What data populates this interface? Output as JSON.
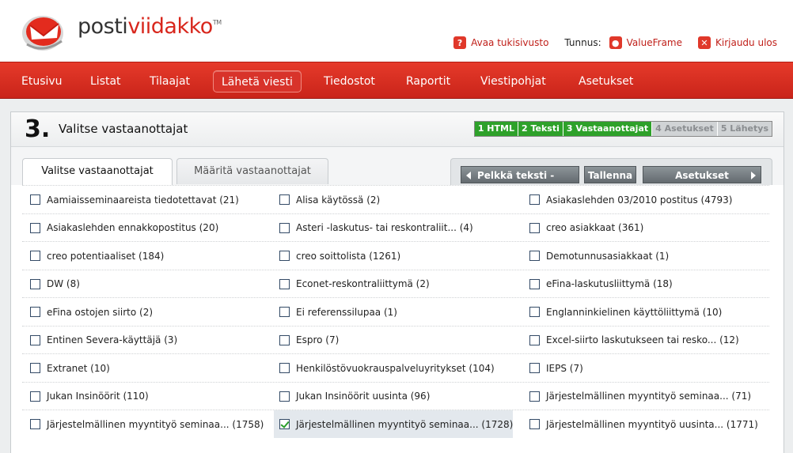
{
  "brand": {
    "part1": "posti",
    "part2": "viidakko",
    "tm": "TM"
  },
  "topnav": {
    "support": "Avaa tukisivusto",
    "account_label": "Tunnus:",
    "account_name": "ValueFrame",
    "logout": "Kirjaudu ulos"
  },
  "nav": [
    "Etusivu",
    "Listat",
    "Tilaajat",
    "Lähetä viesti",
    "Tiedostot",
    "Raportit",
    "Viestipohjat",
    "Asetukset"
  ],
  "step": {
    "number": "3.",
    "title": "Valitse vastaanottajat"
  },
  "steps": [
    "1 HTML",
    "2 Teksti",
    "3 Vastaanottajat",
    "4 Asetukset",
    "5 Lähetys"
  ],
  "tabs": {
    "active": "Valitse vastaanottajat",
    "inactive": "Määritä vastaanottajat"
  },
  "buttons": {
    "plain_text": "Pelkkä teksti -versio",
    "save": "Tallenna",
    "settings": "Asetukset"
  },
  "lists": [
    [
      "Aamiaisseminaareista tiedotettavat (21)",
      "Alisa käytössä (2)",
      "Asiakaslehden 03/2010 postitus (4793)"
    ],
    [
      "Asiakaslehden ennakkopostitus (20)",
      "Asteri -laskutus- tai reskontraliit... (4)",
      "creo asiakkaat (361)"
    ],
    [
      "creo potentiaaliset (184)",
      "creo soittolista (1261)",
      "Demotunnusasiakkaat (1)"
    ],
    [
      "DW (8)",
      "Econet-reskontraliittymä (2)",
      "eFina-laskutusliittymä (18)"
    ],
    [
      "eFina ostojen siirto (2)",
      "Ei referenssilupaa (1)",
      "Englanninkielinen käyttöliittymä (10)"
    ],
    [
      "Entinen Severa-käyttäjä (3)",
      "Espro (7)",
      "Excel-siirto laskutukseen tai resko... (12)"
    ],
    [
      "Extranet (10)",
      "Henkilöstövuokrauspalveluyritykset (104)",
      "IEPS (7)"
    ],
    [
      "Jukan Insinöörit (110)",
      "Jukan Insinöörit uusinta (96)",
      "Järjestelmällinen myyntityö seminaa... (71)"
    ],
    [
      "Järjestelmällinen myyntityö seminaa... (1758)",
      "Järjestelmällinen myyntityö seminaa... (1728)",
      "Järjestelmällinen myyntityö uusinta... (1771)"
    ]
  ]
}
